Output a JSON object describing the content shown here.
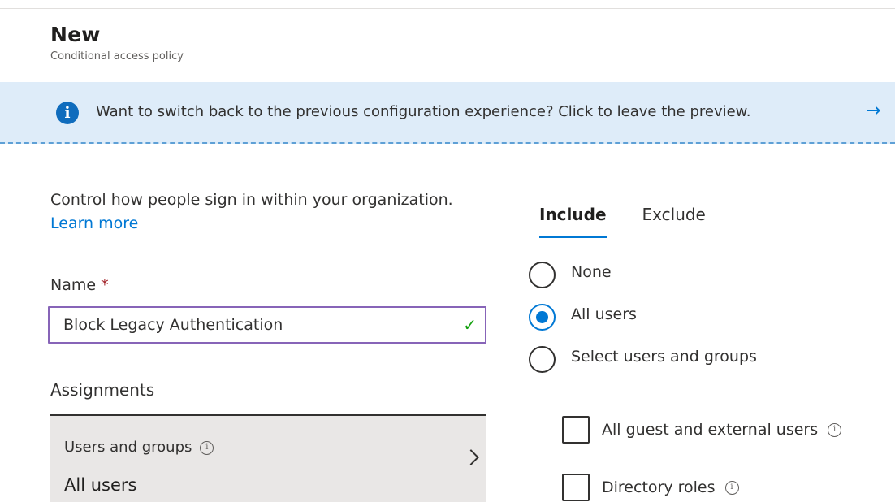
{
  "header": {
    "title": "New",
    "subtitle": "Conditional access policy"
  },
  "banner": {
    "text": "Want to switch back to the previous configuration experience? Click to leave the preview.",
    "arrow": "→",
    "info_glyph": "i"
  },
  "intro": {
    "text": "Control how people sign in within your organization.",
    "link": "Learn more"
  },
  "name_field": {
    "label": "Name",
    "required_mark": "*",
    "value": "Block Legacy Authentication",
    "valid_icon": "check-icon"
  },
  "assignments": {
    "label": "Assignments",
    "item": {
      "title": "Users and groups",
      "value": "All users"
    }
  },
  "tabs": [
    {
      "label": "Include",
      "active": true
    },
    {
      "label": "Exclude",
      "active": false
    }
  ],
  "user_options": [
    {
      "label": "None",
      "checked": false
    },
    {
      "label": "All users",
      "checked": true
    },
    {
      "label": "Select users and groups",
      "checked": false
    }
  ],
  "sub_options": [
    {
      "label": "All guest and external users",
      "checked": false
    },
    {
      "label": "Directory roles",
      "checked": false
    }
  ],
  "colors": {
    "accent": "#0078d4",
    "banner_bg": "#deecf9",
    "input_border": "#8764b8",
    "valid": "#13a10e",
    "required": "#a4262c"
  }
}
